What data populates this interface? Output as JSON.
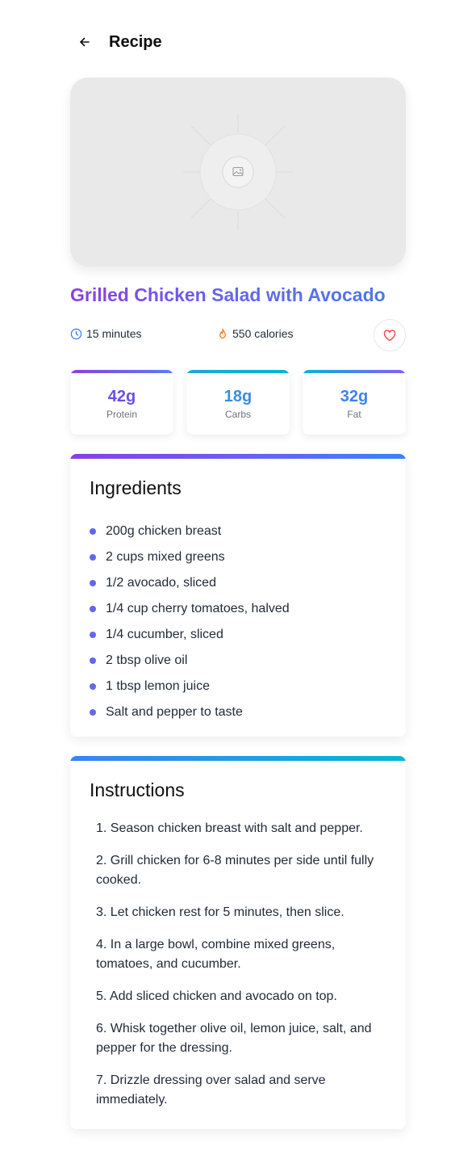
{
  "header": {
    "title": "Recipe",
    "back_icon": "arrow-left-icon"
  },
  "hero": {
    "icon": "image-placeholder-icon"
  },
  "recipe": {
    "title": "Grilled Chicken Salad with Avocado",
    "time": "15 minutes",
    "calories": "550 calories",
    "time_icon": "clock-icon",
    "calories_icon": "flame-icon",
    "favorite_icon": "heart-icon"
  },
  "macros": [
    {
      "value": "42g",
      "label": "Protein"
    },
    {
      "value": "18g",
      "label": "Carbs"
    },
    {
      "value": "32g",
      "label": "Fat"
    }
  ],
  "ingredients": {
    "title": "Ingredients",
    "items": [
      "200g chicken breast",
      "2 cups mixed greens",
      "1/2 avocado, sliced",
      "1/4 cup cherry tomatoes, halved",
      "1/4 cucumber, sliced",
      "2 tbsp olive oil",
      "1 tbsp lemon juice",
      "Salt and pepper to taste"
    ]
  },
  "instructions": {
    "title": "Instructions",
    "steps": [
      "1. Season chicken breast with salt and pepper.",
      "2. Grill chicken for 6-8 minutes per side until fully cooked.",
      "3. Let chicken rest for 5 minutes, then slice.",
      "4. In a large bowl, combine mixed greens, tomatoes, and cucumber.",
      "5. Add sliced chicken and avocado on top.",
      "6. Whisk together olive oil, lemon juice, salt, and pepper for the dressing.",
      "7. Drizzle dressing over salad and serve immediately."
    ]
  },
  "colors": {
    "accent_purple": "#8b3fe0",
    "accent_indigo": "#6366f1",
    "accent_blue": "#3b82f6",
    "accent_cyan": "#06b6d4",
    "heart_red": "#ef4444",
    "flame_orange": "#f97316"
  }
}
